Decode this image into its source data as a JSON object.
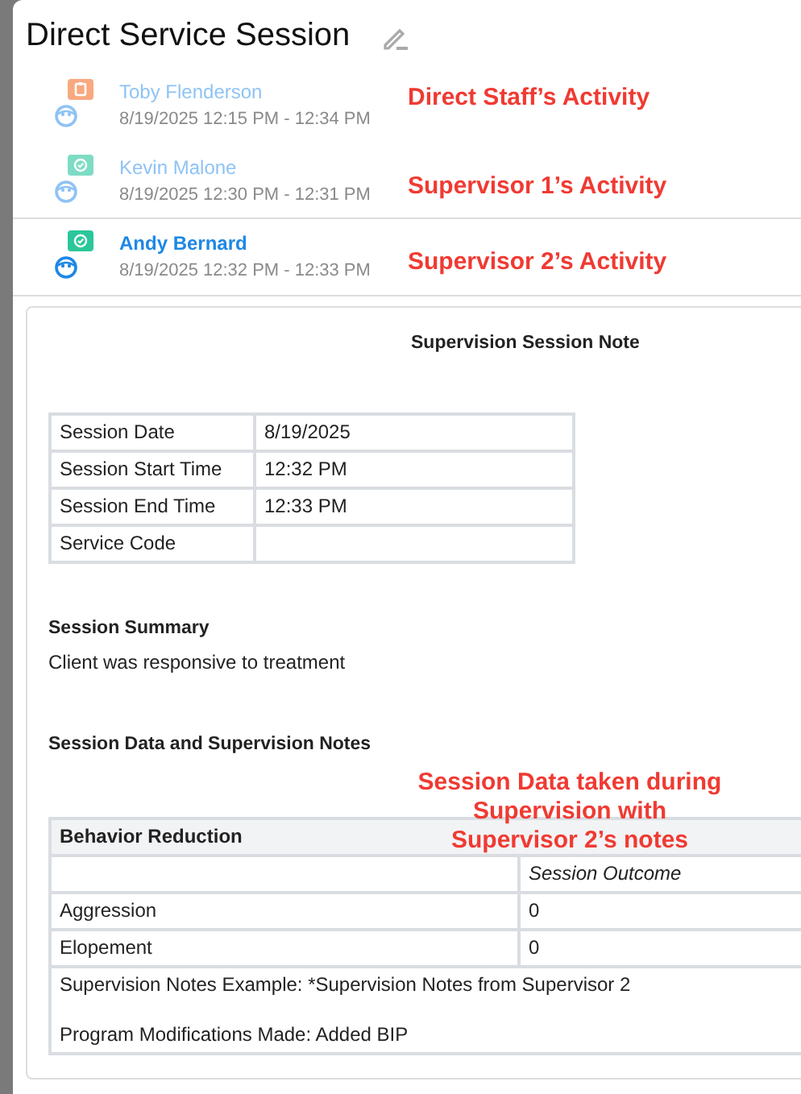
{
  "title": "Direct Service Session",
  "activities": [
    {
      "name": "Toby Flenderson",
      "time": "8/19/2025 12:15 PM - 12:34 PM",
      "kind": "clipboard",
      "color": "#f8a980",
      "selected": false,
      "annotation": "Direct Staff’s Activity"
    },
    {
      "name": "Kevin Malone",
      "time": "8/19/2025 12:30 PM - 12:31 PM",
      "kind": "check",
      "color": "#7edcc4",
      "selected": false,
      "annotation": "Supervisor 1’s Activity"
    },
    {
      "name": "Andy Bernard",
      "time": "8/19/2025 12:32 PM - 12:33 PM",
      "kind": "check",
      "color": "#2bc79a",
      "selected": true,
      "annotation": "Supervisor 2’s Activity"
    }
  ],
  "note": {
    "title": "Supervision Session Note",
    "details": [
      {
        "label": "Session Date",
        "value": "8/19/2025"
      },
      {
        "label": "Session Start Time",
        "value": "12:32 PM"
      },
      {
        "label": "Session End Time",
        "value": "12:33 PM"
      },
      {
        "label": "Service Code"
      }
    ],
    "summary": {
      "heading": "Session Summary",
      "text": "Client was responsive to treatment"
    },
    "session_data": {
      "heading": "Session Data and Supervision Notes",
      "annotation": "Session Data taken during Supervision with Supervisor 2’s notes",
      "table": {
        "title": "Behavior Reduction",
        "column_header": "Session Outcome",
        "rows": [
          {
            "label": "Aggression",
            "value": "0"
          },
          {
            "label": "Elopement",
            "value": "0"
          }
        ],
        "notes": [
          "Supervision Notes Example: *Supervision Notes from Supervisor 2",
          "Program Modifications Made: Added BIP"
        ]
      }
    }
  }
}
